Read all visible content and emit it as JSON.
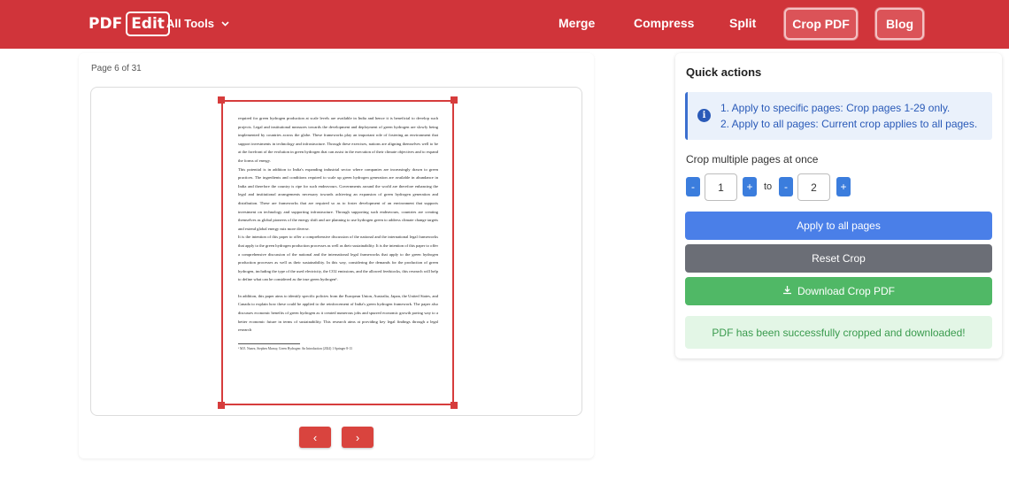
{
  "header": {
    "logo_text": "PDF",
    "logo_badge": "Edit",
    "all_tools_label": "All Tools",
    "nav": [
      "Merge",
      "Compress",
      "Split"
    ],
    "crop_pdf_label": "Crop PDF",
    "blog_label": "Blog",
    "brand_color": "#d0343a"
  },
  "viewer": {
    "page_indicator": "Page 6 of 31",
    "prev_glyph": "‹",
    "next_glyph": "›",
    "document_paragraphs": [
      "required for green hydrogen production at scale levels are available in India and hence it is beneficial to develop such projects. Legal and institutional measures towards the development and deployment of green hydrogen are slowly being implemented by countries across the globe. These frameworks play an important role of fostering an environment that support investments in technology and infrastructure. Through these exercises, nations are aligning themselves well to be at the forefront of the evolution in green hydrogen that can assist in the execution of their climate objectives and to expand the forms of energy.",
      "This potential is in addition to India's expanding industrial sector where companies are increasingly drawn to green practices. The ingredients and conditions required to scale up green hydrogen generation are available in abundance in India and therefore the country is ripe for such endeavours. Governments around the world are therefore enhancing the legal and institutional arrangements necessary towards achieving an expansion of green hydrogen generation and distribution. These are frameworks that are required so as to foster development of an environment that supports investment on technology and supporting infrastructure. Through supporting such endeavours, countries are creating themselves as global pioneers of the energy shift and are planning to use hydrogen green to address climate change targets and extend global energy mix more diverse.",
      "It is the intention of this paper to offer a comprehensive discussion of the national and the international legal frameworks that apply to the green hydrogen production processes as well as their sustainability. It is the intention of this paper to offer a comprehensive discussion of the national and the international legal frameworks that apply to the green hydrogen production processes as well as their sustainability. In this way, considering the demands for the production of green hydrogen, including the type of the used electricity, the CO2 emissions, and the allowed feedstocks, this research will help to define what can be considered as the true green hydrogen¹.",
      "In addition, this paper aims to identify specific policies from the European Union, Australia, Japan, the United States, and Canada to explain how these could be applied to the reinforcement of India's green hydrogen framework. The paper also discusses economic benefits of green hydrogen as it created numerous jobs and spurred economic growth paving way to a better economic future in terms of sustainability. This research aims at providing key legal findings through a legal research"
    ],
    "footnote": "¹ M.E. Nunez, Stephen Murray, Green Hydrogen: An Introduction (2024) 1 Springer 8-13"
  },
  "quick_actions": {
    "title": "Quick actions",
    "info_lines": [
      "1. Apply to specific pages: Crop pages 1-29 only.",
      "2. Apply to all pages: Current crop applies to all pages."
    ],
    "crop_multiple_label": "Crop multiple pages at once",
    "minus_glyph": "-",
    "plus_glyph": "+",
    "from_value": "1",
    "to_label": "to",
    "to_value": "2",
    "apply_all_label": "Apply to all pages",
    "reset_label": "Reset Crop",
    "download_label": "Download Crop PDF",
    "success_message": "PDF has been successfully cropped and downloaded!",
    "colors": {
      "apply": "#4a7fe8",
      "reset": "#6b6e76",
      "download": "#50b866",
      "info": "#2a5ab8"
    }
  }
}
